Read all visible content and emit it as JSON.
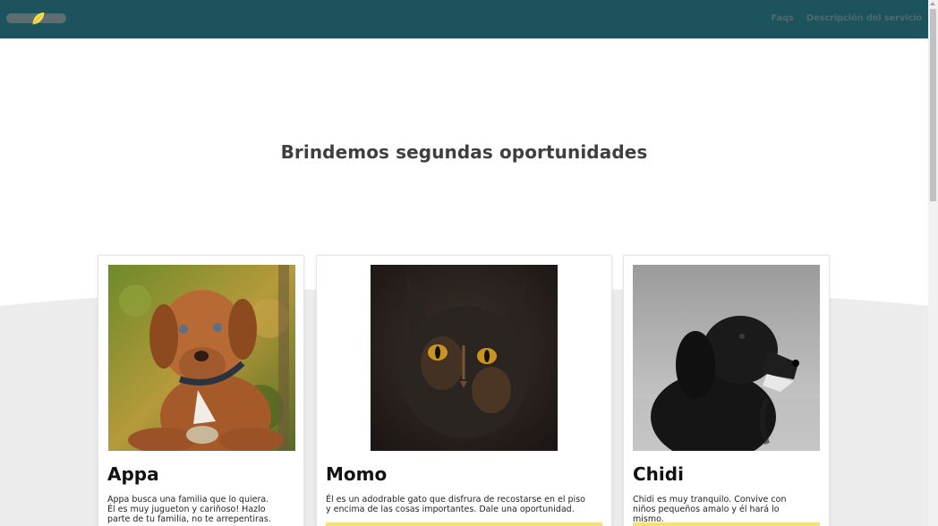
{
  "header": {
    "nav": [
      "Faqs",
      "Descripción del servicio"
    ],
    "accent_color": "#1d535d"
  },
  "hero": {
    "title": "Brindemos segundas oportunidades"
  },
  "cards": [
    {
      "name": "Appa",
      "description": "Appa busca una familia que lo quiera. Él es muy jugueton y cariñoso! Hazlo parte de tu familia, no te arrepentiras.",
      "photo": "brown-puppy-photo"
    },
    {
      "name": "Momo",
      "description": "Él es un adodrable gato que disfrura de recostarse en el piso y encima de las cosas importantes. Dale una oportunidad.",
      "photo": "tortoiseshell-cat-photo"
    },
    {
      "name": "Chidi",
      "description": "Chidi es muy tranquilo. Convive con niños pequeños amalo y él hará lo mismo.",
      "photo": "black-dog-photo"
    }
  ],
  "button_color": "#f3e27a"
}
